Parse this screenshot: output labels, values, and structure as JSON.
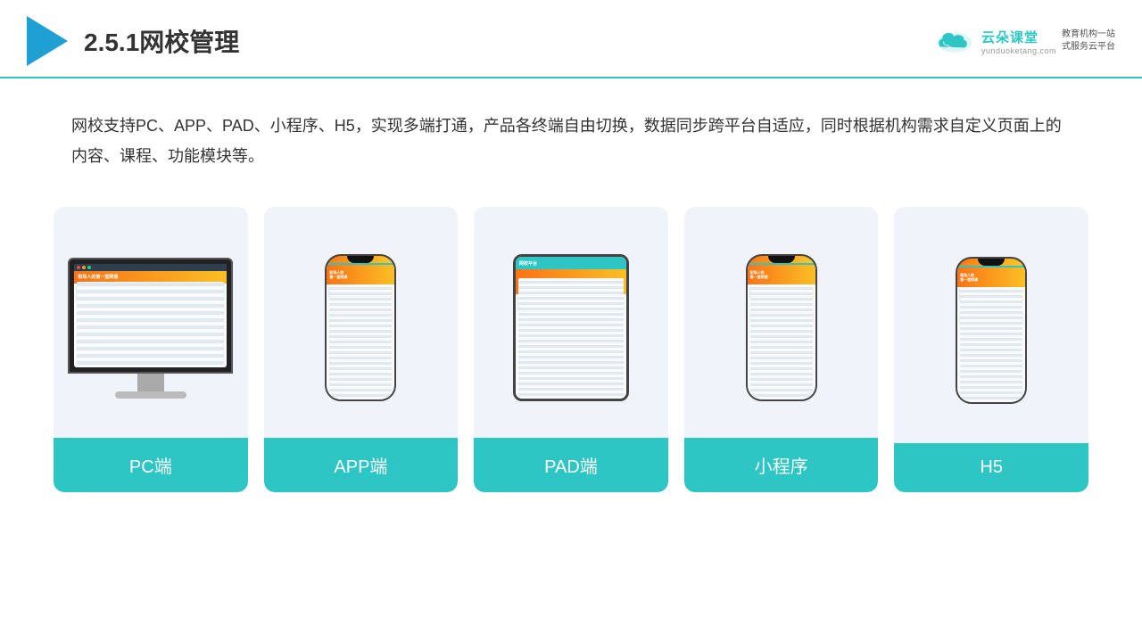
{
  "header": {
    "title": "2.5.1网校管理",
    "brand": {
      "name": "云朵课堂",
      "url": "yunduoketang.com",
      "slogan": "教育机构一站\n式服务云平台"
    }
  },
  "description": {
    "text": "网校支持PC、APP、PAD、小程序、H5，实现多端打通，产品各终端自由切换，数据同步跨平台自适应，同时根据机构需求自定义页面上的内容、课程、功能模块等。"
  },
  "cards": [
    {
      "id": "pc",
      "label": "PC端",
      "type": "pc"
    },
    {
      "id": "app",
      "label": "APP端",
      "type": "phone"
    },
    {
      "id": "pad",
      "label": "PAD端",
      "type": "tablet"
    },
    {
      "id": "miniprogram",
      "label": "小程序",
      "type": "phone"
    },
    {
      "id": "h5",
      "label": "H5",
      "type": "phone"
    }
  ],
  "accent_color": "#2ec5c5"
}
